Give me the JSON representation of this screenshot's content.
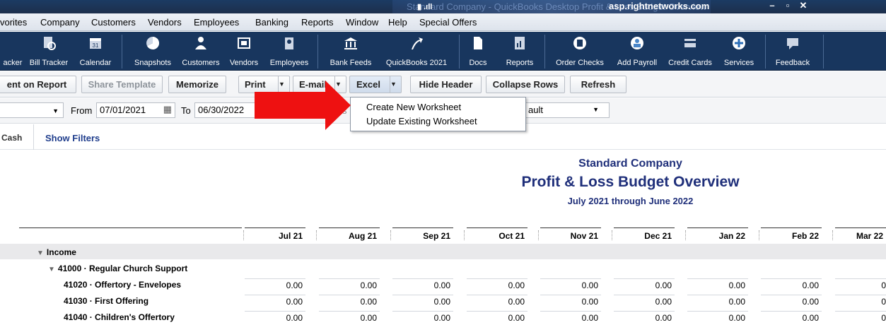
{
  "titlebar": {
    "ghost_text": "Standard Company - QuickBooks Desktop Profit & Loss Budget Overview",
    "host": "asp.rightnetworks.com",
    "signal": "▮ .ıll",
    "minimize": "–",
    "restore": "▫",
    "close": "✕"
  },
  "menu": [
    "vorites",
    "Company",
    "Customers",
    "Vendors",
    "Employees",
    "Banking",
    "Reports",
    "Window",
    "Help",
    "Special Offers"
  ],
  "toolbar": [
    {
      "label": "acker",
      "icon": "partial-icon"
    },
    {
      "label": "Bill Tracker",
      "icon": "bill-tracker-icon"
    },
    {
      "label": "Calendar",
      "icon": "calendar-icon"
    },
    {
      "label": "Snapshots",
      "icon": "pie-chart-icon"
    },
    {
      "label": "Customers",
      "icon": "customers-icon"
    },
    {
      "label": "Vendors",
      "icon": "vendors-icon"
    },
    {
      "label": "Employees",
      "icon": "employees-icon"
    },
    {
      "label": "Bank Feeds",
      "icon": "bank-icon"
    },
    {
      "label": "QuickBooks 2021",
      "icon": "arrow-up-icon"
    },
    {
      "label": "Docs",
      "icon": "docs-icon"
    },
    {
      "label": "Reports",
      "icon": "reports-icon"
    },
    {
      "label": "Order Checks",
      "icon": "order-checks-icon"
    },
    {
      "label": "Add Payroll",
      "icon": "add-payroll-icon"
    },
    {
      "label": "Credit Cards",
      "icon": "credit-cards-icon"
    },
    {
      "label": "Services",
      "icon": "plus-circle-icon"
    },
    {
      "label": "Feedback",
      "icon": "feedback-icon"
    }
  ],
  "report_buttons": {
    "comment": "ent on Report",
    "share_template": "Share Template",
    "memorize": "Memorize",
    "print": "Print",
    "email": "E-mail",
    "excel": "Excel",
    "hide_header": "Hide Header",
    "collapse_rows": "Collapse Rows",
    "refresh": "Refresh",
    "dropdown_glyph": "▼"
  },
  "filter": {
    "from_label": "From",
    "from_value": "07/01/2021",
    "to_label": "To",
    "to_value": "06/30/2022",
    "hidden_partial": "s",
    "layout_partial": "ault",
    "calendar_glyph": "▦"
  },
  "excel_menu": {
    "create_new": "Create New Worksheet",
    "update_existing": "Update Existing Worksheet"
  },
  "filters_row": {
    "basis_partial": "Cash",
    "show_filters": "Show Filters"
  },
  "report": {
    "company": "Standard Company",
    "title": "Profit & Loss Budget Overview",
    "period": "July 2021 through June 2022",
    "columns": [
      "Jul 21",
      "Aug 21",
      "Sep 21",
      "Oct 21",
      "Nov 21",
      "Dec 21",
      "Jan 22",
      "Feb 22",
      "Mar 22"
    ],
    "rows": [
      {
        "label": "Income",
        "level": 0,
        "toggle": "▼",
        "values": []
      },
      {
        "label": "41000 · Regular Church Support",
        "level": 1,
        "toggle": "▼",
        "values": []
      },
      {
        "label": "41020 · Offertory - Envelopes",
        "level": 2,
        "values": [
          "0.00",
          "0.00",
          "0.00",
          "0.00",
          "0.00",
          "0.00",
          "0.00",
          "0.00",
          "0"
        ]
      },
      {
        "label": "41030 · First Offering",
        "level": 2,
        "values": [
          "0.00",
          "0.00",
          "0.00",
          "0.00",
          "0.00",
          "0.00",
          "0.00",
          "0.00",
          "0"
        ]
      },
      {
        "label": "41040 · Children's Offertory",
        "level": 2,
        "values": [
          "0.00",
          "0.00",
          "0.00",
          "0.00",
          "0.00",
          "0.00",
          "0.00",
          "0.00",
          "0"
        ]
      }
    ]
  },
  "colors": {
    "titlebar": "#1b3b63",
    "toolbar": "#18365e",
    "report_title": "#1f2f7a",
    "arrow": "#ee1111",
    "show_filters": "#1f3d8c"
  }
}
